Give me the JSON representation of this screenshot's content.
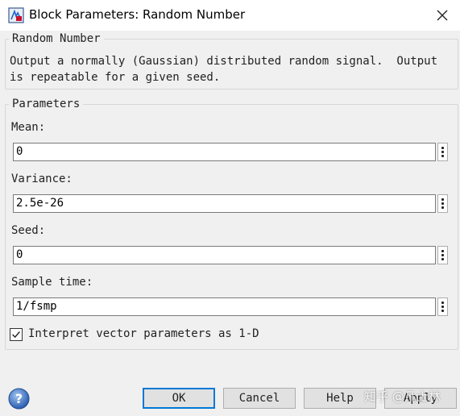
{
  "window": {
    "title": "Block Parameters: Random Number"
  },
  "block": {
    "name": "Random Number",
    "description_line1": "Output a normally (Gaussian) distributed random signal.  Output",
    "description_line2": "is repeatable for a given seed."
  },
  "parameters": {
    "group_label": "Parameters",
    "mean": {
      "label": "Mean:",
      "value": "0"
    },
    "variance": {
      "label": "Variance:",
      "value": "2.5e-26"
    },
    "seed": {
      "label": "Seed:",
      "value": "0"
    },
    "sample_time": {
      "label": "Sample time:",
      "value": "1/fsmp"
    },
    "interpret_vector": {
      "label": "Interpret vector parameters as 1-D",
      "checked": true
    }
  },
  "buttons": {
    "ok": "OK",
    "cancel": "Cancel",
    "help": "Help",
    "apply": "Apply"
  },
  "watermark": "知乎 @凡士林",
  "colors": {
    "default_button_border": "#0078d7",
    "title_bar": "#ffffff",
    "dialog_bg": "#f0f0f0"
  },
  "icons": {
    "app": "simulink-block-icon",
    "close": "close-icon",
    "help": "help-icon",
    "param_menu": "kebab-menu-icon",
    "check": "checkmark-icon"
  }
}
